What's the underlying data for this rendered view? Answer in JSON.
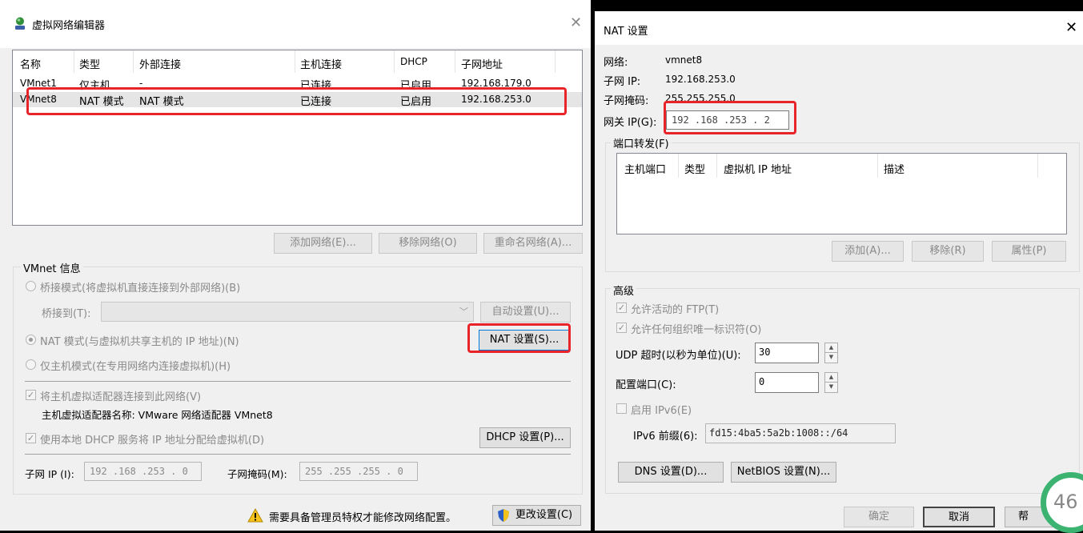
{
  "left": {
    "title": "虚拟网络编辑器",
    "close": "✕",
    "table": {
      "headers": [
        "名称",
        "类型",
        "外部连接",
        "主机连接",
        "DHCP",
        "子网地址"
      ],
      "rows": [
        [
          "VMnet1",
          "仅主机...",
          "-",
          "已连接",
          "已启用",
          "192.168.179.0"
        ],
        [
          "VMnet8",
          "NAT 模式",
          "NAT 模式",
          "已连接",
          "已启用",
          "192.168.253.0"
        ]
      ]
    },
    "buttons": {
      "add_network": "添加网络(E)...",
      "remove_network": "移除网络(O)",
      "rename_network": "重命名网络(A)..."
    },
    "vmnet_info": {
      "legend": "VMnet 信息",
      "bridge_radio": "桥接模式(将虚拟机直接连接到外部网络)(B)",
      "bridge_to_label": "桥接到(T):",
      "auto_settings": "自动设置(U)...",
      "nat_radio": "NAT 模式(与虚拟机共享主机的 IP 地址)(N)",
      "nat_settings": "NAT 设置(S)...",
      "hostonly_radio": "仅主机模式(在专用网络内连接虚拟机)(H)",
      "connect_adapter": "将主机虚拟适配器连接到此网络(V)",
      "adapter_name": "主机虚拟适配器名称: VMware 网络适配器 VMnet8",
      "use_dhcp": "使用本地 DHCP 服务将 IP 地址分配给虚拟机(D)",
      "dhcp_settings": "DHCP 设置(P)...",
      "subnet_ip_label": "子网 IP (I):",
      "subnet_ip": "192 .168 .253 .  0",
      "subnet_mask_label": "子网掩码(M):",
      "subnet_mask": "255 .255 .255 .  0"
    },
    "footer": {
      "admin_notice": "需要具备管理员特权才能修改网络配置。",
      "change_settings": "更改设置(C)"
    }
  },
  "right": {
    "title": "NAT 设置",
    "close": "✕",
    "network_label": "网络:",
    "network_value": "vmnet8",
    "subnet_ip_label": "子网 IP:",
    "subnet_ip_value": "192.168.253.0",
    "subnet_mask_label": "子网掩码:",
    "subnet_mask_value": "255.255.255.0",
    "gateway_label": "网关 IP(G):",
    "gateway_value": "192 .168 .253 .  2",
    "port_forwarding": {
      "legend": "端口转发(F)",
      "headers": [
        "主机端口",
        "类型",
        "虚拟机 IP 地址",
        "描述"
      ],
      "add": "添加(A)...",
      "remove": "移除(R)",
      "properties": "属性(P)"
    },
    "advanced": {
      "legend": "高级",
      "allow_ftp": "允许活动的 FTP(T)",
      "allow_uuid": "允许任何组织唯一标识符(O)",
      "udp_timeout_label": "UDP 超时(以秒为单位)(U):",
      "udp_timeout": "30",
      "config_port_label": "配置端口(C):",
      "config_port": "0",
      "enable_ipv6": "启用 IPv6(E)",
      "ipv6_prefix_label": "IPv6 前缀(6):",
      "ipv6_prefix": "fd15:4ba5:5a2b:1008::/64",
      "dns_settings": "DNS 设置(D)...",
      "netbios_settings": "NetBIOS 设置(N)..."
    },
    "footer": {
      "ok": "确定",
      "cancel": "取消",
      "help": "帮"
    }
  },
  "overlay": {
    "badge": "46"
  },
  "colors": {
    "highlight": "#e8242a",
    "badge_ring": "#3cb371"
  }
}
